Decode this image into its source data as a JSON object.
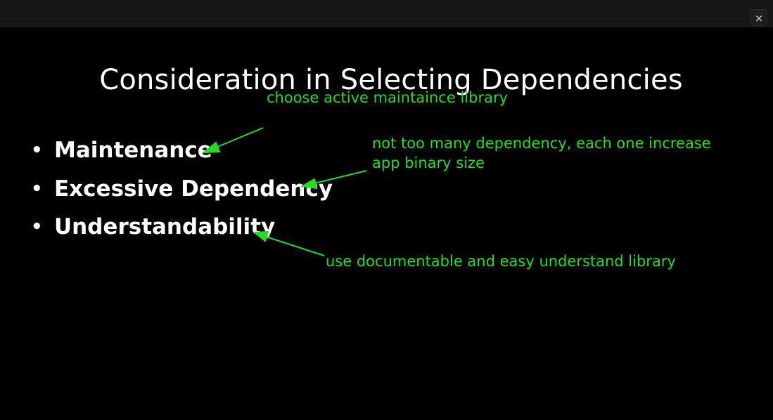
{
  "window": {
    "close_glyph": "×"
  },
  "slide": {
    "title": "Consideration in Selecting Dependencies",
    "bullets": [
      {
        "text": "Maintenance"
      },
      {
        "text": "Excessive Dependency"
      },
      {
        "text": "Understandability"
      }
    ],
    "bullet_glyph": "•"
  },
  "annotations": [
    {
      "text": "choose active maintaince library"
    },
    {
      "lines": [
        "not too many dependency, each one increase",
        "app binary size"
      ]
    },
    {
      "text": "use documentable and easy understand library"
    }
  ],
  "colors": {
    "background": "#000000",
    "topbar": "#161616",
    "title_text": "#ffffff",
    "annotation": "#22dd22"
  }
}
